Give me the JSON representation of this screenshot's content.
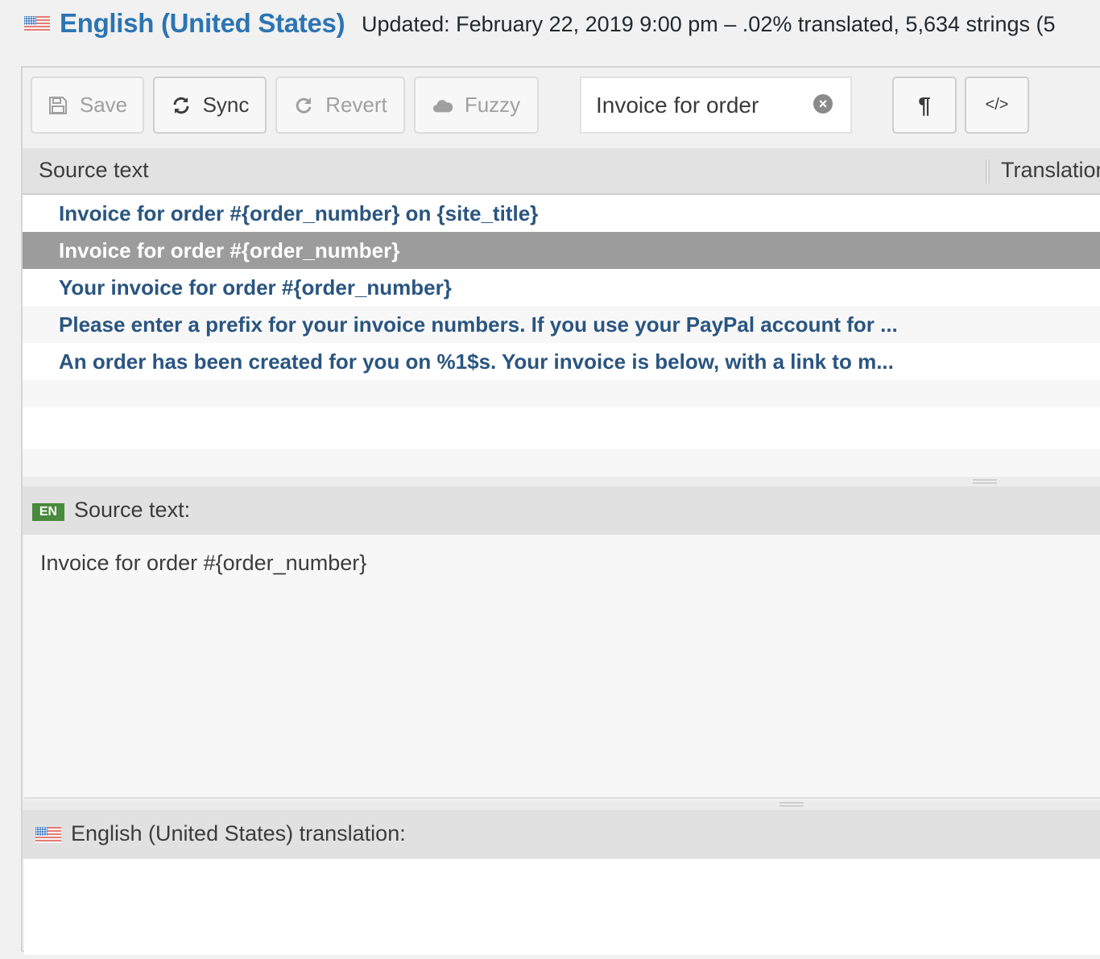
{
  "header": {
    "flag_icon": "us-flag-icon",
    "title": "English (United States)",
    "meta": "Updated: February 22, 2019 9:00 pm – .02% translated, 5,634 strings (5"
  },
  "toolbar": {
    "save_label": "Save",
    "save_icon": "floppy-disk-icon",
    "sync_label": "Sync",
    "sync_icon": "refresh-icon",
    "revert_label": "Revert",
    "revert_icon": "undo-icon",
    "fuzzy_label": "Fuzzy",
    "fuzzy_icon": "cloud-icon",
    "search_value": "Invoice for order",
    "search_clear_icon": "clear-circle-x-icon",
    "invisibles_label": "¶",
    "code_label": "</>"
  },
  "list": {
    "columns": {
      "source": "Source text",
      "translation": "Translation"
    },
    "rows": [
      {
        "source": "Invoice for order #{order_number} on {site_title}",
        "selected": false
      },
      {
        "source": "Invoice for order #{order_number}",
        "selected": true
      },
      {
        "source": "Your invoice for order #{order_number}",
        "selected": false
      },
      {
        "source": "Please enter a prefix for your invoice numbers. If you use your PayPal account for ...",
        "selected": false
      },
      {
        "source": "An order has been created for you on %1$s. Your invoice is below, with a link to m...",
        "selected": false
      }
    ]
  },
  "source_panel": {
    "lang_badge": "EN",
    "label": "Source text:",
    "text": "Invoice for order #{order_number}"
  },
  "translation_panel": {
    "flag_icon": "us-flag-icon",
    "label": "English (United States) translation:",
    "value": ""
  },
  "colors": {
    "title": "#2c74b3",
    "row_text": "#2a5580",
    "selected_row": "#9c9c9c",
    "en_badge": "#4a8a3c"
  }
}
